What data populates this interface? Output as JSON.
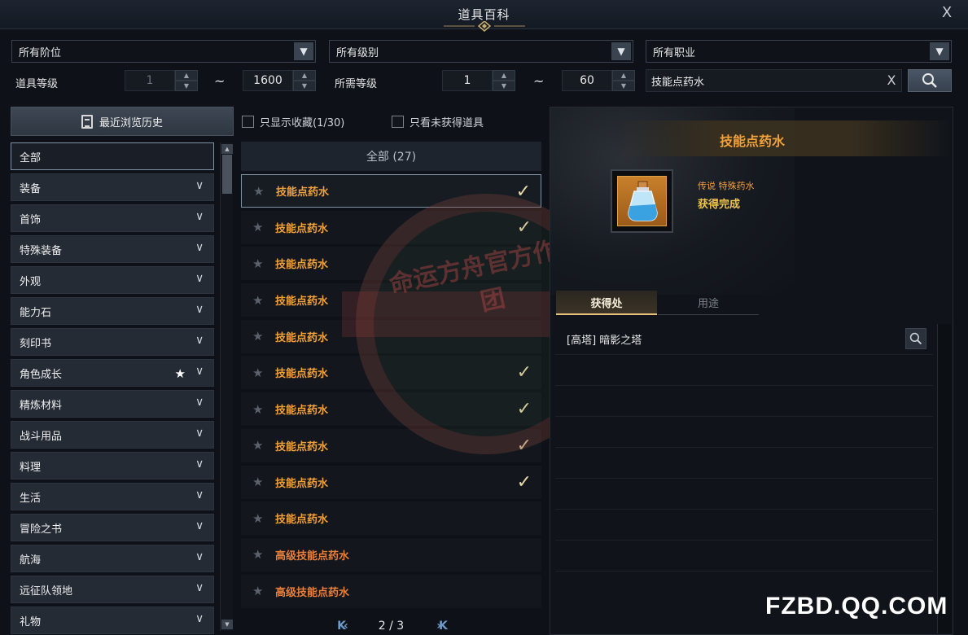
{
  "window": {
    "title": "道具百科",
    "close": "X"
  },
  "filters": {
    "tier_select": "所有阶位",
    "grade_select": "所有级别",
    "class_select": "所有职业",
    "item_level_label": "道具等级",
    "item_level_min": "1",
    "item_level_max": "1600",
    "required_level_label": "所需等级",
    "required_level_min": "1",
    "required_level_max": "60",
    "range_sep": "~",
    "search_value": "技能点药水",
    "search_clear": "X"
  },
  "history_button": "最近浏览历史",
  "options": {
    "show_favorites": "只显示收藏(1/30)",
    "show_unobtained": "只看未获得道具"
  },
  "categories": [
    {
      "label": "全部"
    },
    {
      "label": "装备"
    },
    {
      "label": "首饰"
    },
    {
      "label": "特殊装备"
    },
    {
      "label": "外观"
    },
    {
      "label": "能力石"
    },
    {
      "label": "刻印书"
    },
    {
      "label": "角色成长"
    },
    {
      "label": "精炼材料"
    },
    {
      "label": "战斗用品"
    },
    {
      "label": "料理"
    },
    {
      "label": "生活"
    },
    {
      "label": "冒险之书"
    },
    {
      "label": "航海"
    },
    {
      "label": "远征队领地"
    },
    {
      "label": "礼物"
    }
  ],
  "item_list": {
    "header": "全部 (27)",
    "items": [
      {
        "name": "技能点药水",
        "obtained": true
      },
      {
        "name": "技能点药水",
        "obtained": true
      },
      {
        "name": "技能点药水",
        "obtained": false
      },
      {
        "name": "技能点药水",
        "obtained": false
      },
      {
        "name": "技能点药水",
        "obtained": false
      },
      {
        "name": "技能点药水",
        "obtained": true
      },
      {
        "name": "技能点药水",
        "obtained": true
      },
      {
        "name": "技能点药水",
        "obtained": true
      },
      {
        "name": "技能点药水",
        "obtained": true
      },
      {
        "name": "技能点药水",
        "obtained": false
      },
      {
        "name": "高级技能点药水",
        "obtained": false
      },
      {
        "name": "高级技能点药水",
        "obtained": false
      }
    ],
    "pager": {
      "first_prev": "K‹",
      "page": "2 / 3",
      "next_last": "›K"
    }
  },
  "detail": {
    "name": "技能点药水",
    "grade": "传说 特殊药水",
    "status": "获得完成",
    "tabs": [
      "获得处",
      "用途"
    ],
    "sources": [
      "[高塔] 暗影之塔"
    ]
  },
  "watermark": "命运方舟官方作者团",
  "site_mark": "FZBD.QQ.COM",
  "colors": {
    "accent_orange": "#f0a13a",
    "advanced_orange": "#e87f3a",
    "gold": "#f0c64a",
    "selection_border": "#7e93a6"
  }
}
